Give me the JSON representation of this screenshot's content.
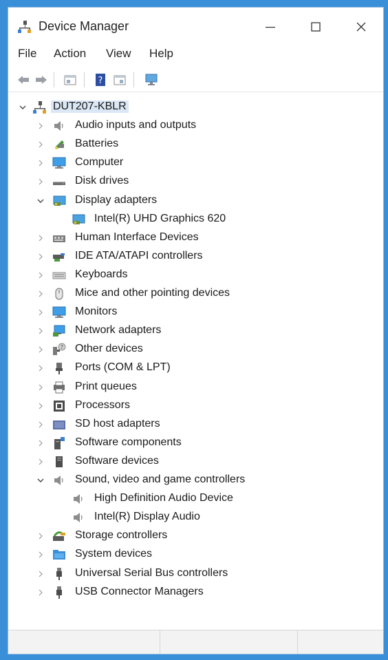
{
  "window": {
    "title": "Device Manager"
  },
  "menu": [
    "File",
    "Action",
    "View",
    "Help"
  ],
  "toolbar": [
    "back-arrow-icon",
    "forward-arrow-icon",
    "properties-sheet-icon",
    "help-icon",
    "view-icon",
    "monitor-scan-icon"
  ],
  "tree": {
    "root": "DUT207-KBLR",
    "categories": [
      {
        "label": "Audio inputs and outputs",
        "icon": "speaker-icon",
        "expanded": false
      },
      {
        "label": "Batteries",
        "icon": "battery-icon",
        "expanded": false
      },
      {
        "label": "Computer",
        "icon": "computer-icon",
        "expanded": false
      },
      {
        "label": "Disk drives",
        "icon": "disk-drive-icon",
        "expanded": false
      },
      {
        "label": "Display adapters",
        "icon": "display-adapter-icon",
        "expanded": true,
        "children": [
          "Intel(R) UHD Graphics 620"
        ]
      },
      {
        "label": "Human Interface Devices",
        "icon": "hid-icon",
        "expanded": false
      },
      {
        "label": "IDE ATA/ATAPI controllers",
        "icon": "ide-controller-icon",
        "expanded": false
      },
      {
        "label": "Keyboards",
        "icon": "keyboard-icon",
        "expanded": false
      },
      {
        "label": "Mice and other pointing devices",
        "icon": "mouse-icon",
        "expanded": false
      },
      {
        "label": "Monitors",
        "icon": "monitor-icon",
        "expanded": false
      },
      {
        "label": "Network adapters",
        "icon": "network-adapter-icon",
        "expanded": false
      },
      {
        "label": "Other devices",
        "icon": "unknown-device-icon",
        "expanded": false
      },
      {
        "label": "Ports (COM & LPT)",
        "icon": "port-icon",
        "expanded": false
      },
      {
        "label": "Print queues",
        "icon": "printer-icon",
        "expanded": false
      },
      {
        "label": "Processors",
        "icon": "processor-icon",
        "expanded": false
      },
      {
        "label": "SD host adapters",
        "icon": "sd-card-icon",
        "expanded": false
      },
      {
        "label": "Software components",
        "icon": "software-component-icon",
        "expanded": false
      },
      {
        "label": "Software devices",
        "icon": "software-device-icon",
        "expanded": false
      },
      {
        "label": "Sound, video and game controllers",
        "icon": "speaker-icon",
        "expanded": true,
        "children": [
          "High Definition Audio Device",
          "Intel(R) Display Audio"
        ]
      },
      {
        "label": "Storage controllers",
        "icon": "storage-controller-icon",
        "expanded": false
      },
      {
        "label": "System devices",
        "icon": "system-folder-icon",
        "expanded": false
      },
      {
        "label": "Universal Serial Bus controllers",
        "icon": "usb-icon",
        "expanded": false
      },
      {
        "label": "USB Connector Managers",
        "icon": "usb-icon",
        "expanded": false
      }
    ]
  }
}
